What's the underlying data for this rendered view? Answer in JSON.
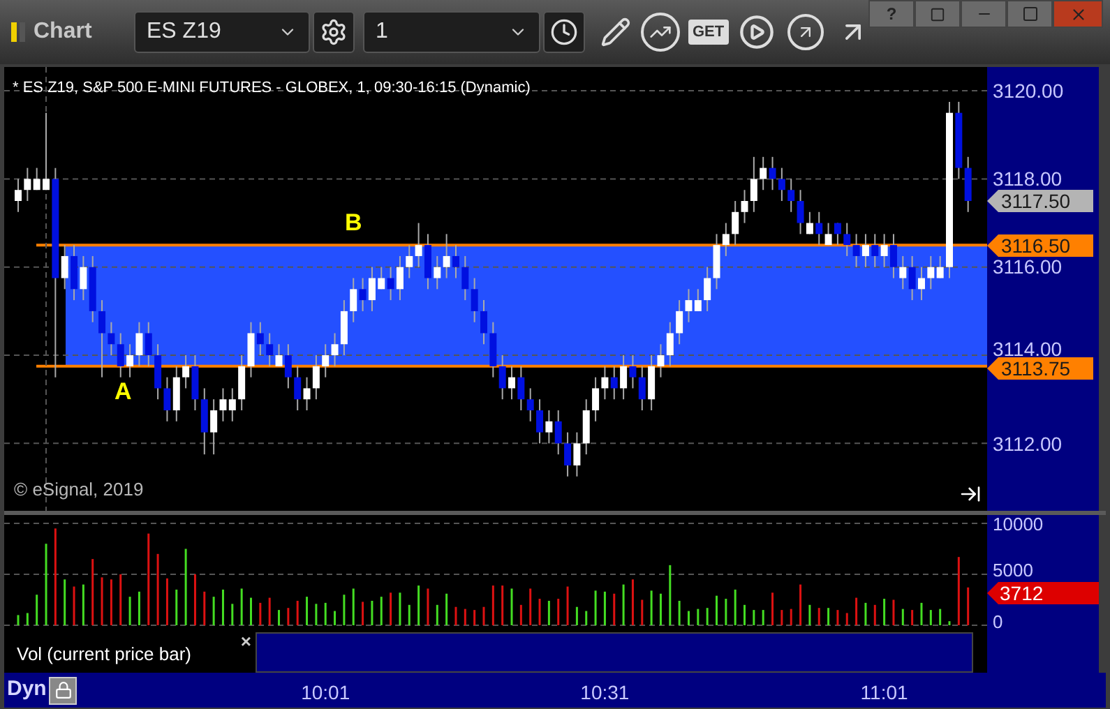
{
  "window": {
    "title": "Chart",
    "help": "?"
  },
  "toolbar": {
    "symbol": "ES Z19",
    "interval": "1",
    "get_label": "GET"
  },
  "chart": {
    "header": "* ES Z19, S&P 500 E-MINI FUTURES - GLOBEX, 1, 09:30-16:15 (Dynamic)",
    "copyright": "© eSignal, 2019",
    "annotations": [
      {
        "label": "A"
      },
      {
        "label": "B"
      }
    ],
    "price_tags": [
      {
        "value": "3117.50",
        "kind": "last"
      },
      {
        "value": "3116.50",
        "kind": "level"
      },
      {
        "value": "3113.75",
        "kind": "level"
      }
    ],
    "chart_data": {
      "type": "candlestick",
      "ylim": [
        3110.47,
        3120.54
      ],
      "grid": true,
      "yticks": [
        {
          "value": 3120,
          "label": "3120.00"
        },
        {
          "value": 3118,
          "label": "3118.00"
        },
        {
          "value": 3116,
          "label": "3116.00"
        },
        {
          "value": 3114,
          "label": "3114.00"
        },
        {
          "value": 3112,
          "label": "3112.00"
        }
      ],
      "categories": [
        null,
        null,
        null,
        null,
        null,
        null,
        null,
        null,
        null,
        null,
        null,
        null,
        null,
        null,
        null,
        null,
        null,
        null,
        null,
        null,
        null,
        null,
        null,
        null,
        null,
        null,
        null,
        null,
        null,
        null,
        null,
        null,
        null,
        null,
        null,
        null,
        null,
        null,
        null,
        null,
        null,
        null,
        null,
        null,
        null,
        null,
        null,
        null,
        null,
        null,
        null,
        null,
        null,
        null,
        null,
        null,
        null,
        null,
        null,
        null,
        null,
        null,
        null,
        null,
        null,
        null,
        null,
        null,
        null,
        null,
        null,
        null,
        null,
        null,
        null,
        null,
        null,
        null,
        null,
        null,
        null,
        null,
        null,
        null,
        null,
        null,
        null,
        null,
        null,
        null,
        null,
        null,
        null,
        null,
        null,
        null,
        null,
        null,
        null,
        null,
        null,
        null,
        null
      ],
      "ohlc": [
        [
          3117.5,
          3118,
          3117.25,
          3117.75
        ],
        [
          3117.75,
          3118.25,
          3117.5,
          3118
        ],
        [
          3117.75,
          3118.25,
          3117.75,
          3118
        ],
        [
          3117.75,
          3119.5,
          3117.75,
          3118
        ],
        [
          3118,
          3118.25,
          3113.5,
          3115.75
        ],
        [
          3115.75,
          3116.5,
          3115.5,
          3116.25
        ],
        [
          3116.25,
          3116.5,
          3115.25,
          3115.5
        ],
        [
          3115.5,
          3116.25,
          3115.25,
          3116
        ],
        [
          3116,
          3116.25,
          3114.75,
          3115
        ],
        [
          3115,
          3115.25,
          3113.5,
          3114.5
        ],
        [
          3114.5,
          3114.75,
          3114,
          3114.25
        ],
        [
          3114.25,
          3114.5,
          3113.5,
          3113.75
        ],
        [
          3113.75,
          3114.25,
          3113.5,
          3114
        ],
        [
          3114,
          3114.75,
          3113.75,
          3114.5
        ],
        [
          3114.5,
          3114.75,
          3113.75,
          3114
        ],
        [
          3114,
          3114.25,
          3113,
          3113.25
        ],
        [
          3113.25,
          3113.5,
          3112.5,
          3112.75
        ],
        [
          3112.75,
          3113.75,
          3112.5,
          3113.5
        ],
        [
          3113.5,
          3114,
          3113.25,
          3113.75
        ],
        [
          3113.75,
          3114,
          3112.75,
          3113
        ],
        [
          3113,
          3113.25,
          3111.75,
          3112.25
        ],
        [
          3112.25,
          3113,
          3111.75,
          3112.75
        ],
        [
          3112.75,
          3113.25,
          3112.5,
          3113
        ],
        [
          3112.75,
          3113.25,
          3112.5,
          3113
        ],
        [
          3113,
          3114,
          3112.75,
          3113.75
        ],
        [
          3113.75,
          3114.75,
          3113.5,
          3114.5
        ],
        [
          3114.5,
          3114.75,
          3114,
          3114.25
        ],
        [
          3114.25,
          3114.5,
          3113.75,
          3114
        ],
        [
          3113.75,
          3114.25,
          3113.75,
          3114
        ],
        [
          3114,
          3114.25,
          3113.25,
          3113.5
        ],
        [
          3113.5,
          3113.75,
          3112.75,
          3113
        ],
        [
          3113,
          3113.5,
          3112.75,
          3113.25
        ],
        [
          3113.25,
          3114,
          3113,
          3113.75
        ],
        [
          3113.75,
          3114.25,
          3113.5,
          3114
        ],
        [
          3114,
          3114.5,
          3113.75,
          3114.25
        ],
        [
          3114.25,
          3115.25,
          3114,
          3115
        ],
        [
          3115,
          3115.75,
          3114.75,
          3115.5
        ],
        [
          3115.5,
          3115.75,
          3115,
          3115.25
        ],
        [
          3115.25,
          3116,
          3115,
          3115.75
        ],
        [
          3115.5,
          3116,
          3115.5,
          3115.75
        ],
        [
          3115.75,
          3116,
          3115.25,
          3115.5
        ],
        [
          3115.5,
          3116.25,
          3115.25,
          3116
        ],
        [
          3116,
          3116.5,
          3115.75,
          3116.25
        ],
        [
          3116.25,
          3117,
          3116,
          3116.5
        ],
        [
          3116.5,
          3116.75,
          3115.5,
          3115.75
        ],
        [
          3115.75,
          3116.25,
          3115.5,
          3116
        ],
        [
          3116,
          3116.75,
          3115.75,
          3116.25
        ],
        [
          3116.25,
          3116.5,
          3115.75,
          3116
        ],
        [
          3116,
          3116.25,
          3115.25,
          3115.5
        ],
        [
          3115.5,
          3115.75,
          3114.75,
          3115
        ],
        [
          3115,
          3115.25,
          3114.25,
          3114.5
        ],
        [
          3114.5,
          3114.75,
          3113.5,
          3113.75
        ],
        [
          3113.75,
          3114,
          3113,
          3113.25
        ],
        [
          3113.25,
          3113.75,
          3113,
          3113.5
        ],
        [
          3113.5,
          3113.75,
          3112.75,
          3113
        ],
        [
          3113,
          3113.25,
          3112.5,
          3112.75
        ],
        [
          3112.75,
          3113,
          3112,
          3112.25
        ],
        [
          3112.25,
          3112.75,
          3112,
          3112.5
        ],
        [
          3112.5,
          3112.75,
          3111.75,
          3112
        ],
        [
          3112,
          3112.25,
          3111.25,
          3111.5
        ],
        [
          3111.5,
          3112.25,
          3111.25,
          3112
        ],
        [
          3112,
          3113,
          3111.75,
          3112.75
        ],
        [
          3112.75,
          3113.5,
          3112.5,
          3113.25
        ],
        [
          3113.25,
          3113.75,
          3113,
          3113.5
        ],
        [
          3113.5,
          3113.75,
          3113,
          3113.25
        ],
        [
          3113.25,
          3114,
          3113,
          3113.75
        ],
        [
          3113.75,
          3114,
          3113.25,
          3113.5
        ],
        [
          3113.5,
          3113.75,
          3112.75,
          3113
        ],
        [
          3113,
          3114,
          3112.75,
          3113.75
        ],
        [
          3113.75,
          3114.25,
          3113.5,
          3114
        ],
        [
          3114,
          3114.75,
          3113.75,
          3114.5
        ],
        [
          3114.5,
          3115.25,
          3114.25,
          3115
        ],
        [
          3115,
          3115.5,
          3114.75,
          3115.25
        ],
        [
          3115,
          3115.5,
          3115,
          3115.25
        ],
        [
          3115.25,
          3116,
          3115,
          3115.75
        ],
        [
          3115.75,
          3116.75,
          3115.5,
          3116.5
        ],
        [
          3116.5,
          3117,
          3116.25,
          3116.75
        ],
        [
          3116.75,
          3117.5,
          3116.5,
          3117.25
        ],
        [
          3117.25,
          3117.75,
          3117,
          3117.5
        ],
        [
          3117.5,
          3118.5,
          3117.25,
          3118
        ],
        [
          3118,
          3118.5,
          3117.75,
          3118.25
        ],
        [
          3118.25,
          3118.5,
          3117.75,
          3118
        ],
        [
          3118,
          3118.25,
          3117.5,
          3117.75
        ],
        [
          3117.75,
          3118,
          3117.25,
          3117.5
        ],
        [
          3117.5,
          3117.75,
          3116.75,
          3117
        ],
        [
          3116.75,
          3117.25,
          3116.75,
          3117
        ],
        [
          3117,
          3117.25,
          3116.5,
          3116.75
        ],
        [
          3116.5,
          3117,
          3116.5,
          3116.75
        ],
        [
          3117,
          3117,
          3116.5,
          3116.75
        ],
        [
          3116.75,
          3117,
          3116.25,
          3116.5
        ],
        [
          3116.5,
          3116.75,
          3116,
          3116.25
        ],
        [
          3116.25,
          3116.75,
          3116,
          3116.5
        ],
        [
          3116.5,
          3116.75,
          3116,
          3116.25
        ],
        [
          3116.25,
          3116.75,
          3116,
          3116.5
        ],
        [
          3116.5,
          3116.75,
          3115.75,
          3116
        ],
        [
          3115.75,
          3116.25,
          3115.5,
          3116
        ],
        [
          3116,
          3116.25,
          3115.25,
          3115.5
        ],
        [
          3115.5,
          3116,
          3115.25,
          3115.75
        ],
        [
          3115.75,
          3116.25,
          3115.5,
          3116
        ],
        [
          3115.75,
          3116.25,
          3115.75,
          3116
        ],
        [
          3116,
          3119.75,
          3115.75,
          3119.5
        ],
        [
          3119.5,
          3119.75,
          3118,
          3118.25
        ],
        [
          3118.25,
          3118.5,
          3117.25,
          3117.5
        ]
      ]
    }
  },
  "volume": {
    "tag": "3712",
    "label": "Vol (current price bar)",
    "close": "×",
    "chart_data": {
      "type": "bar",
      "ylim": [
        -685,
        10822
      ],
      "grid": true,
      "yticks": [
        {
          "value": 10000,
          "label": "10000"
        },
        {
          "value": 5000,
          "label": "5000"
        },
        {
          "value": 0,
          "label": "0"
        }
      ],
      "categories": [
        null,
        null,
        null,
        null,
        null,
        null,
        null,
        null,
        null,
        null,
        null,
        null,
        null,
        null,
        null,
        null,
        null,
        null,
        null,
        null,
        null,
        null,
        null,
        null,
        null,
        null,
        null,
        null,
        null,
        null,
        null,
        null,
        null,
        null,
        null,
        null,
        null,
        null,
        null,
        null,
        null,
        null,
        null,
        null,
        null,
        null,
        null,
        null,
        null,
        null,
        null,
        null,
        null,
        null,
        null,
        null,
        null,
        null,
        null,
        null,
        null,
        null,
        null,
        null,
        null,
        null,
        null,
        null,
        null,
        null,
        null,
        null,
        null,
        null,
        null,
        null,
        null,
        null,
        null,
        null,
        null,
        null,
        null,
        null,
        null,
        null,
        null,
        null,
        null,
        null,
        null,
        null,
        null,
        null,
        null,
        null,
        null,
        null,
        null,
        null,
        null,
        null,
        null
      ],
      "values": [
        1000,
        1200,
        3000,
        8000,
        9500,
        4500,
        3800,
        4000,
        6500,
        4700,
        4500,
        5000,
        2800,
        3300,
        9000,
        7000,
        4600,
        3500,
        7500,
        5000,
        3300,
        2800,
        3500,
        2100,
        3600,
        2700,
        2200,
        2700,
        1500,
        1700,
        2400,
        2800,
        2100,
        2200,
        1400,
        3000,
        3600,
        2300,
        2400,
        2800,
        3200,
        3200,
        2000,
        3900,
        3600,
        2000,
        3100,
        1800,
        1600,
        1500,
        1800,
        3900,
        3900,
        3600,
        2000,
        3600,
        2600,
        2400,
        2600,
        3800,
        1800,
        1400,
        3400,
        3300,
        3100,
        4000,
        4500,
        2500,
        3400,
        3100,
        5900,
        2400,
        1400,
        1600,
        1700,
        2900,
        2600,
        3500,
        2000,
        1500,
        1500,
        3200,
        1500,
        1600,
        4000,
        2000,
        1700,
        1700,
        1500,
        1200,
        2700,
        2200,
        2000,
        2600,
        2500,
        1600,
        1500,
        2200,
        1500,
        1600,
        400,
        6700,
        3712
      ]
    }
  },
  "time_axis": [
    "10:01",
    "10:31",
    "11:01"
  ],
  "status": "Dyn"
}
